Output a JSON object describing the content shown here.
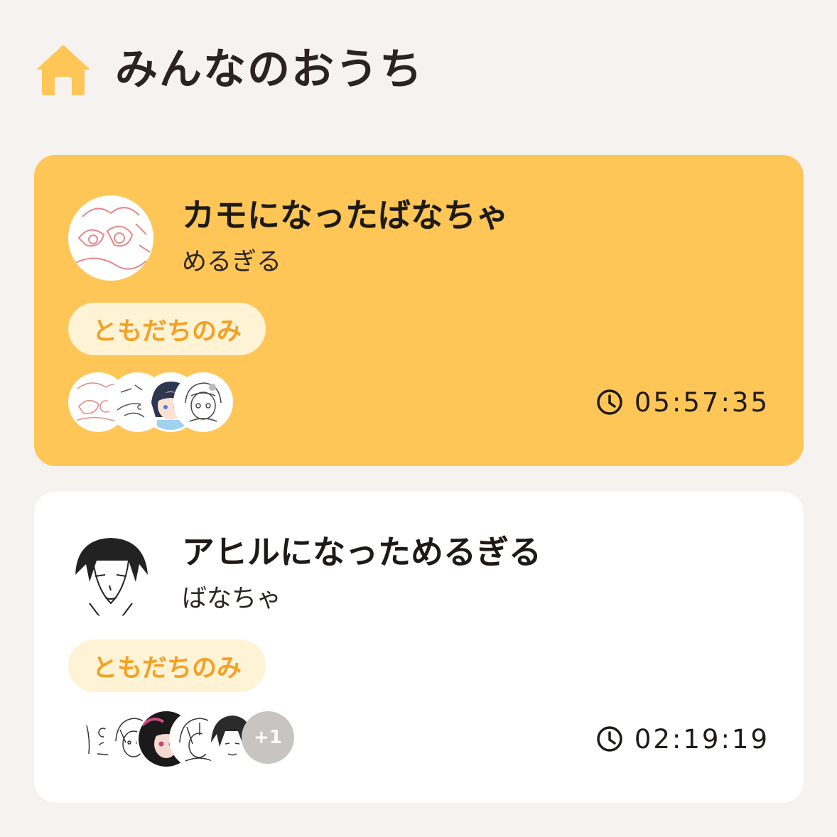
{
  "header": {
    "icon": "home-icon",
    "title": "みんなのおうち",
    "accent_color": "#fec657"
  },
  "rooms": [
    {
      "title": "カモになったばなちゃ",
      "owner": "めるぎる",
      "visibility": "ともだちのみ",
      "timer": "05:57:35",
      "background": "#fec657",
      "member_count_visible": 4,
      "extra_members": ""
    },
    {
      "title": "アヒルになっためるぎる",
      "owner": "ばなちゃ",
      "visibility": "ともだちのみ",
      "timer": "02:19:19",
      "background": "#ffffff",
      "member_count_visible": 5,
      "extra_members": "+1"
    }
  ]
}
